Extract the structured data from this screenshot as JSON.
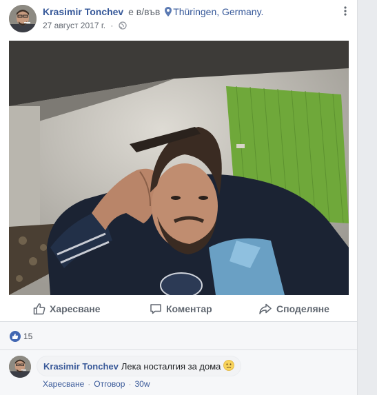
{
  "post": {
    "author": "Krasimir Tonchev",
    "verb": "е в/във",
    "location": "Thüringen, Germany.",
    "date": "27 август 2017 г.",
    "dot": "·"
  },
  "actions": {
    "like": "Харесване",
    "comment": "Коментар",
    "share": "Споделяне"
  },
  "reactions": {
    "count": "15"
  },
  "comment": {
    "author": "Krasimir Tonchev",
    "text": "Лека носталгия за дома",
    "like": "Харесване",
    "reply": "Отговор",
    "time": "30w",
    "sep": "·"
  },
  "colors": {
    "link": "#365899",
    "badge": "#4267b2",
    "blind": "#6fa83a"
  },
  "icons": [
    "more-icon",
    "map-pin-icon",
    "globe-icon",
    "thumbs-up-icon",
    "comment-icon",
    "share-icon",
    "emoji-icon"
  ]
}
